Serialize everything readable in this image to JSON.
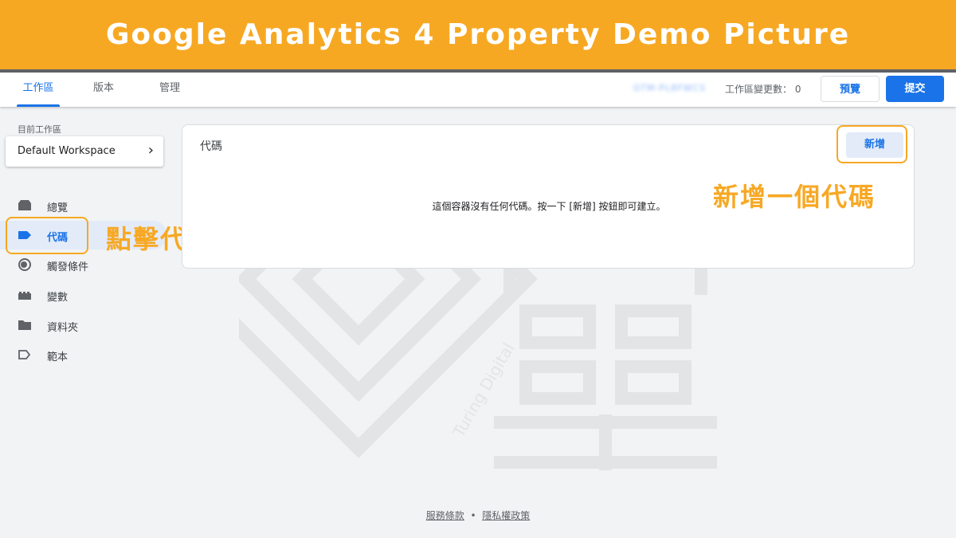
{
  "banner": {
    "title": "Google Analytics 4 Property Demo Picture"
  },
  "topbar": {
    "tabs": [
      {
        "label": "工作區",
        "active": true
      },
      {
        "label": "版本",
        "active": false
      },
      {
        "label": "管理",
        "active": false
      }
    ],
    "container_id": "GTM-PL8FWCS",
    "workspace_changes": "工作區變更數： 0",
    "preview_label": "預覽",
    "submit_label": "提交"
  },
  "sidebar": {
    "workspace_label": "目前工作區",
    "workspace_name": "Default Workspace",
    "items": [
      {
        "label": "總覽",
        "icon": "overview-icon"
      },
      {
        "label": "代碼",
        "icon": "tag-icon",
        "active": true
      },
      {
        "label": "觸發條件",
        "icon": "trigger-icon"
      },
      {
        "label": "變數",
        "icon": "variables-icon"
      },
      {
        "label": "資料夾",
        "icon": "folder-icon"
      },
      {
        "label": "範本",
        "icon": "template-icon"
      }
    ]
  },
  "main": {
    "card_title": "代碼",
    "new_button_label": "新增",
    "empty_message": "這個容器沒有任何代碼。按一下 [新增] 按鈕即可建立。"
  },
  "annotations": {
    "left_callout": "點擊代碼頁面",
    "right_callout": "新增一個代碼",
    "highlight_color": "#f7a823"
  },
  "watermark": {
    "text": "Turing Digital"
  },
  "footer": {
    "terms": "服務條款",
    "separator": "•",
    "privacy": "隱私權政策"
  },
  "colors": {
    "banner": "#f7a823",
    "accent": "#1a73e8",
    "background": "#f1f3f4"
  }
}
